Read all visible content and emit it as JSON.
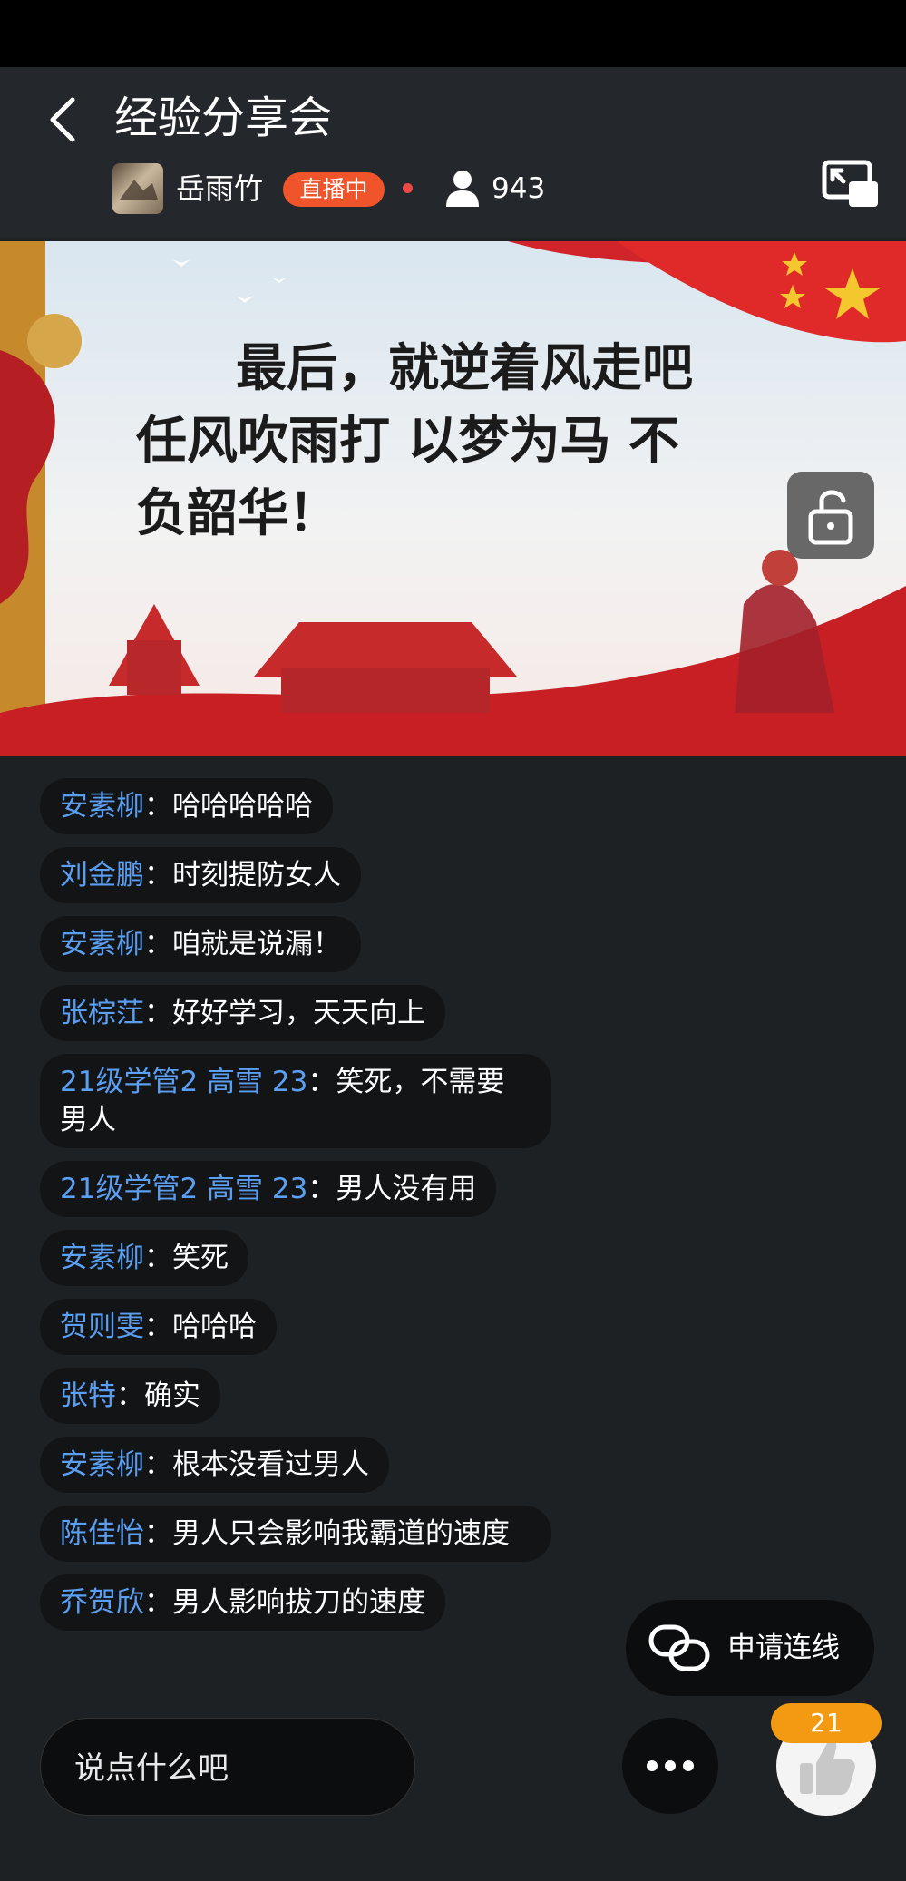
{
  "header": {
    "title": "经验分享会",
    "host_name": "岳雨竹",
    "live_badge": "直播中",
    "viewer_count": "943"
  },
  "video": {
    "slide_lines": [
      "最后，就逆着风走吧",
      "任风吹雨打 以梦为马 不",
      "负韶华！"
    ]
  },
  "chat": [
    {
      "name": "安素柳",
      "text": "哈哈哈哈哈"
    },
    {
      "name": "刘金鹏",
      "text": "时刻提防女人"
    },
    {
      "name": "安素柳",
      "text": "咱就是说漏！"
    },
    {
      "name": "张棕茳",
      "text": "好好学习，天天向上"
    },
    {
      "name": "21级学管2 高雪 23",
      "text": "笑死，不需要男人"
    },
    {
      "name": "21级学管2 高雪 23",
      "text": "男人没有用"
    },
    {
      "name": "安素柳",
      "text": "笑死"
    },
    {
      "name": "贺则雯",
      "text": "哈哈哈"
    },
    {
      "name": "张特",
      "text": "确实"
    },
    {
      "name": "安素柳",
      "text": "根本没看过男人"
    },
    {
      "name": "陈佳怡",
      "text": "男人只会影响我霸道的速度"
    },
    {
      "name": "乔贺欣",
      "text": "男人影响拔刀的速度"
    }
  ],
  "chat_separator": "：",
  "bottom": {
    "connect_label": "申请连线",
    "input_placeholder": "说点什么吧",
    "like_count": "21"
  },
  "colors": {
    "name_blue": "#5b9ff2",
    "live_orange": "#f0542b",
    "like_badge": "#f39a12"
  }
}
